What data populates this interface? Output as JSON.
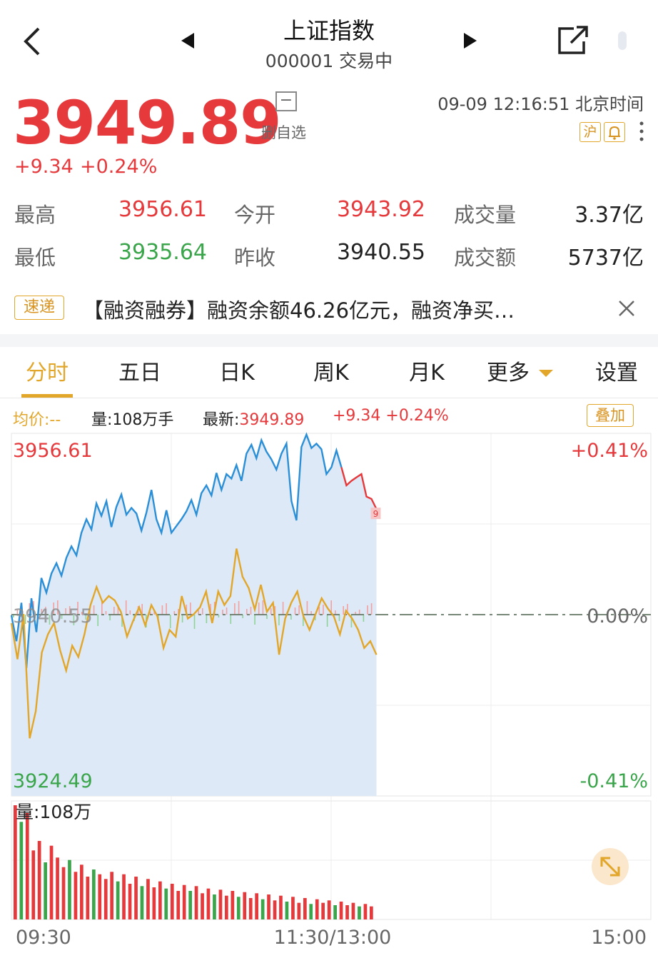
{
  "header": {
    "title": "上证指数",
    "code_status": "000001 交易中",
    "back_icon": "chevron-left-icon",
    "prev_icon": "triangle-left-icon",
    "next_icon": "triangle-right-icon",
    "share_icon": "share-external-icon"
  },
  "quote": {
    "price": "3949.89",
    "change": "+9.34",
    "change_pct": "+0.24%",
    "watch_label": "删自选",
    "time": "09-09 12:16:51 北京时间",
    "market_badge": "沪",
    "alert_icon": "bell-icon",
    "more_icon": "vertical-dots-icon"
  },
  "stats": [
    {
      "label": "最高",
      "value": "3956.61",
      "color": "red"
    },
    {
      "label": "今开",
      "value": "3943.92",
      "color": "red"
    },
    {
      "label": "成交量",
      "value": "3.37亿",
      "color": "plain"
    },
    {
      "label": "最低",
      "value": "3935.64",
      "color": "green"
    },
    {
      "label": "昨收",
      "value": "3940.55",
      "color": "plain"
    },
    {
      "label": "成交额",
      "value": "5737亿",
      "color": "plain"
    }
  ],
  "news": {
    "badge": "速递",
    "text": "【融资融券】融资余额46.26亿元，融资净买…",
    "close_icon": "close-icon"
  },
  "tabs": [
    {
      "label": "分时",
      "active": true
    },
    {
      "label": "五日"
    },
    {
      "label": "日K"
    },
    {
      "label": "周K"
    },
    {
      "label": "月K"
    },
    {
      "label": "更多"
    },
    {
      "label": "设置"
    }
  ],
  "info_bar": {
    "avg_label": "均价:--",
    "volume_label": "量:108万手",
    "latest_label": "最新:",
    "latest_value": "3949.89",
    "change_value": "+9.34 +0.24%",
    "overlay_button": "叠加"
  },
  "chart_data": {
    "type": "line",
    "top_price": "3956.61",
    "base_price": "3940.55",
    "bottom_price": "3924.49",
    "top_pct": "+0.41%",
    "base_pct": "0.00%",
    "bottom_pct": "-0.41%",
    "ylim": [
      3924.49,
      3956.61
    ],
    "minutes_total": 240,
    "minutes_elapsed": 137,
    "last_marker": "9",
    "series": [
      {
        "color": "#2b8fd8",
        "values": [
          3940.5,
          3938.2,
          3941.6,
          3935.8,
          3942.0,
          3939.0,
          3943.8,
          3942.5,
          3944.2,
          3945.1,
          3944.0,
          3945.6,
          3946.6,
          3945.8,
          3947.8,
          3949.0,
          3948.1,
          3950.4,
          3949.3,
          3950.6,
          3948.3,
          3950.1,
          3951.2,
          3949.4,
          3950.0,
          3949.5,
          3948.0,
          3949.6,
          3951.6,
          3949.0,
          3947.8,
          3949.8,
          3947.8,
          3948.4,
          3949.0,
          3949.7,
          3950.7,
          3949.4,
          3951.3,
          3952.0,
          3951.1,
          3953.1,
          3951.6,
          3953.0,
          3952.6,
          3953.8,
          3952.4,
          3954.8,
          3955.6,
          3954.4,
          3956.0,
          3955.0,
          3954.3,
          3953.4,
          3954.8,
          3955.7,
          3950.6,
          3948.9,
          3955.4,
          3956.5,
          3955.3,
          3955.7,
          3955.2,
          3953.0,
          3953.6,
          3955.1,
          3953.6,
          3952.0,
          3952.4,
          3952.7,
          3953.0,
          3951.0,
          3950.8,
          3949.9
        ],
        "recent_color": "#e5393c",
        "recent_from": 66
      },
      {
        "color": "#e2a62a",
        "values": [
          3939.8,
          3936.6,
          3940.6,
          3929.6,
          3932.0,
          3937.2,
          3938.8,
          3939.8,
          3937.4,
          3935.6,
          3937.8,
          3936.8,
          3938.8,
          3941.4,
          3943.0,
          3941.6,
          3942.2,
          3941.8,
          3940.8,
          3938.6,
          3940.0,
          3941.2,
          3939.6,
          3941.4,
          3940.4,
          3937.6,
          3939.2,
          3938.6,
          3942.2,
          3940.2,
          3940.6,
          3941.2,
          3942.6,
          3939.8,
          3942.6,
          3941.4,
          3942.2,
          3946.4,
          3943.9,
          3942.9,
          3941.0,
          3943.2,
          3940.8,
          3941.6,
          3937.0,
          3940.2,
          3941.6,
          3942.6,
          3940.4,
          3939.2,
          3940.6,
          3942.0,
          3941.1,
          3940.4,
          3938.8,
          3940.9,
          3940.2,
          3939.2,
          3937.6,
          3938.2,
          3937.0
        ]
      }
    ],
    "volume": {
      "label": "量:108万",
      "x_start": "09:30",
      "x_mid": "11:30/13:00",
      "x_end": "15:00",
      "bars_up": [
        96,
        82,
        90,
        58,
        66,
        48,
        62,
        52,
        44,
        50,
        40,
        46,
        36,
        42,
        38,
        34,
        40,
        32,
        38,
        30,
        36,
        28,
        34,
        27,
        32,
        26,
        30,
        24,
        29,
        24,
        28,
        22,
        26,
        21,
        25,
        20,
        24,
        19,
        23,
        18,
        22,
        17,
        21,
        16,
        20,
        15,
        19,
        14,
        18,
        13,
        17,
        14,
        16,
        12,
        15,
        12,
        14,
        11,
        13,
        11
      ],
      "expand_icon": "expand-arrows-icon"
    }
  },
  "colors": {
    "up": "#e5393c",
    "down": "#3aa54a",
    "accent": "#e2a62a",
    "line": "#2b8fd8",
    "fill": "#dde9f6"
  }
}
